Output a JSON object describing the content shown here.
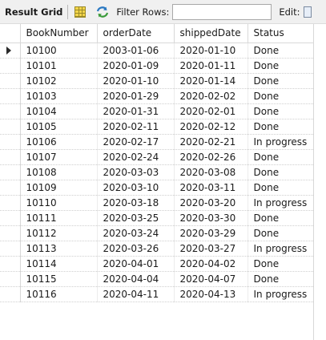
{
  "toolbar": {
    "title": "Result Grid",
    "filter_label": "Filter Rows:",
    "filter_value": "",
    "edit_label": "Edit:"
  },
  "icons": {
    "grid": "grid-view-icon",
    "filter": "filter-rows-icon",
    "edit": "edit-icon",
    "current_row": "current-row-arrow-icon"
  },
  "table": {
    "columns": [
      "BookNumber",
      "orderDate",
      "shippedDate",
      "Status"
    ],
    "current_row_index": 0,
    "rows": [
      [
        "10100",
        "2003-01-06",
        "2020-01-10",
        "Done"
      ],
      [
        "10101",
        "2020-01-09",
        "2020-01-11",
        "Done"
      ],
      [
        "10102",
        "2020-01-10",
        "2020-01-14",
        "Done"
      ],
      [
        "10103",
        "2020-01-29",
        "2020-02-02",
        "Done"
      ],
      [
        "10104",
        "2020-01-31",
        "2020-02-01",
        "Done"
      ],
      [
        "10105",
        "2020-02-11",
        "2020-02-12",
        "Done"
      ],
      [
        "10106",
        "2020-02-17",
        "2020-02-21",
        "In progress"
      ],
      [
        "10107",
        "2020-02-24",
        "2020-02-26",
        "Done"
      ],
      [
        "10108",
        "2020-03-03",
        "2020-03-08",
        "Done"
      ],
      [
        "10109",
        "2020-03-10",
        "2020-03-11",
        "Done"
      ],
      [
        "10110",
        "2020-03-18",
        "2020-03-20",
        "In progress"
      ],
      [
        "10111",
        "2020-03-25",
        "2020-03-30",
        "Done"
      ],
      [
        "10112",
        "2020-03-24",
        "2020-03-29",
        "Done"
      ],
      [
        "10113",
        "2020-03-26",
        "2020-03-27",
        "In progress"
      ],
      [
        "10114",
        "2020-04-01",
        "2020-04-02",
        "Done"
      ],
      [
        "10115",
        "2020-04-04",
        "2020-04-07",
        "Done"
      ],
      [
        "10116",
        "2020-04-11",
        "2020-04-13",
        "In progress"
      ]
    ]
  }
}
